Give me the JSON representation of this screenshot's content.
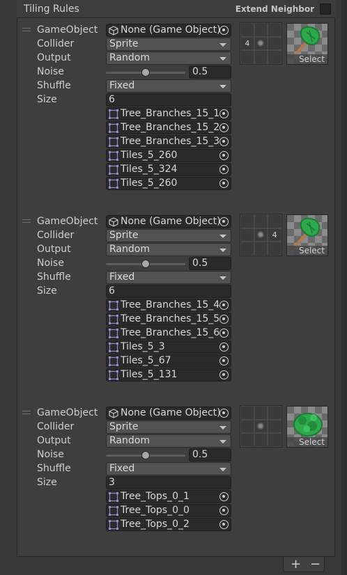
{
  "header": {
    "title": "Tiling Rules",
    "extend_label": "Extend Neighbor"
  },
  "labels": {
    "gameobject": "GameObject",
    "collider": "Collider",
    "output": "Output",
    "noise": "Noise",
    "shuffle": "Shuffle",
    "size": "Size",
    "select": "Select"
  },
  "rules": [
    {
      "gameobject": "None (Game Object)",
      "collider": "Sprite",
      "output": "Random",
      "noise": "0.5",
      "noise_fraction": 0.5,
      "shuffle": "Fixed",
      "size": "6",
      "sprites": [
        "Tree_Branches_15_1",
        "Tree_Branches_15_2",
        "Tree_Branches_15_3",
        "Tiles_5_260",
        "Tiles_5_324",
        "Tiles_5_260"
      ],
      "neighbor_label": "4",
      "neighbor_side": "left",
      "preview_icon": "branch-sprite-icon"
    },
    {
      "gameobject": "None (Game Object)",
      "collider": "Sprite",
      "output": "Random",
      "noise": "0.5",
      "noise_fraction": 0.5,
      "shuffle": "Fixed",
      "size": "6",
      "sprites": [
        "Tree_Branches_15_4",
        "Tree_Branches_15_5",
        "Tree_Branches_15_6",
        "Tiles_5_3",
        "Tiles_5_67",
        "Tiles_5_131"
      ],
      "neighbor_label": "4",
      "neighbor_side": "right",
      "preview_icon": "branch-sprite-icon"
    },
    {
      "gameobject": "None (Game Object)",
      "collider": "Sprite",
      "output": "Random",
      "noise": "0.5",
      "noise_fraction": 0.5,
      "shuffle": "Fixed",
      "size": "3",
      "sprites": [
        "Tree_Tops_0_1",
        "Tree_Tops_0_0",
        "Tree_Tops_0_2"
      ],
      "neighbor_label": "",
      "neighbor_side": "none",
      "preview_icon": "treetop-sprite-icon"
    }
  ],
  "footer": {
    "add": "+",
    "remove": "−"
  },
  "colors": {
    "leaf": "#2ea84a",
    "leaf_dark": "#1d7a34",
    "branch": "#b07a4e"
  }
}
